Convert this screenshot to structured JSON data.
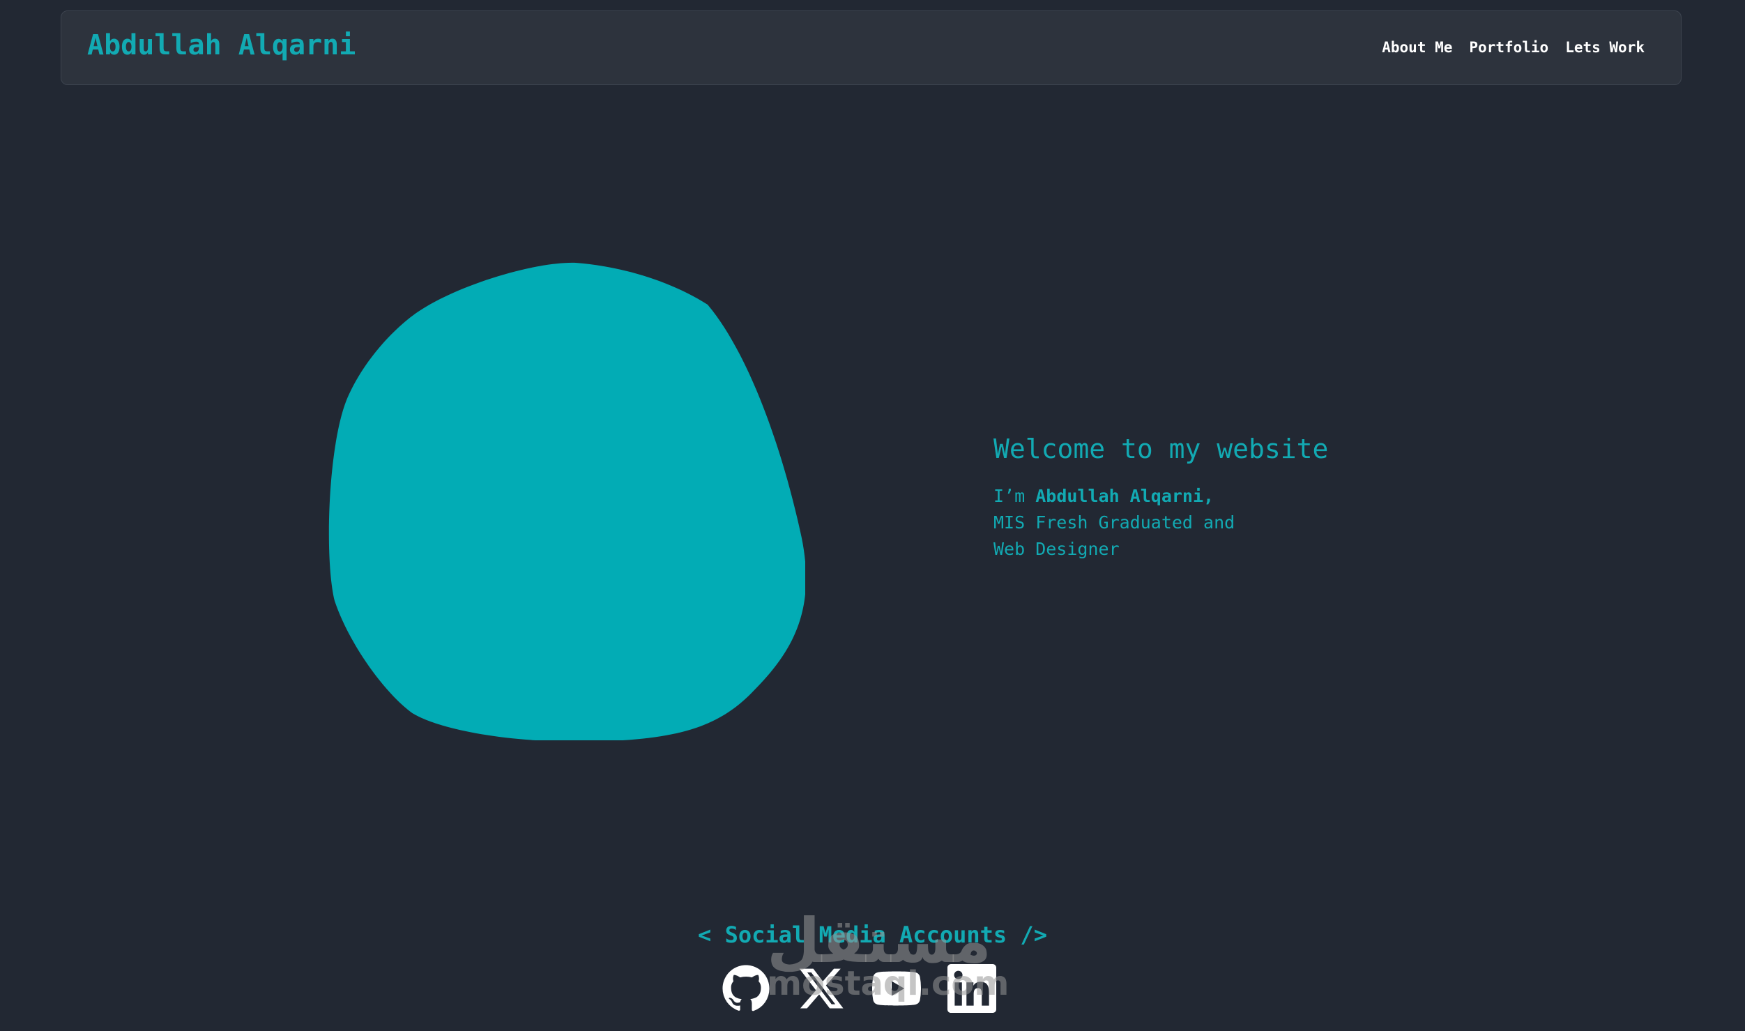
{
  "header": {
    "brand": "Abdullah Alqarni",
    "nav": [
      {
        "label": "About Me"
      },
      {
        "label": "Portfolio"
      },
      {
        "label": "Lets Work"
      }
    ]
  },
  "hero": {
    "title": "Welcome to my website",
    "intro_prefix": "I’m ",
    "name": "Abdullah Alqarni,",
    "line2": "MIS Fresh Graduated and",
    "line3": "Web Designer"
  },
  "social": {
    "heading": "< Social Media Accounts />",
    "icons": [
      "github-icon",
      "x-icon",
      "youtube-icon",
      "linkedin-icon"
    ]
  },
  "watermark": {
    "arabic": "مستقل",
    "latin": "mostaql.com"
  },
  "colors": {
    "background": "#222833",
    "navbar": "#2d333d",
    "accent": "#12aab3",
    "blob": "#02acb5",
    "text_white": "#ffffff"
  }
}
